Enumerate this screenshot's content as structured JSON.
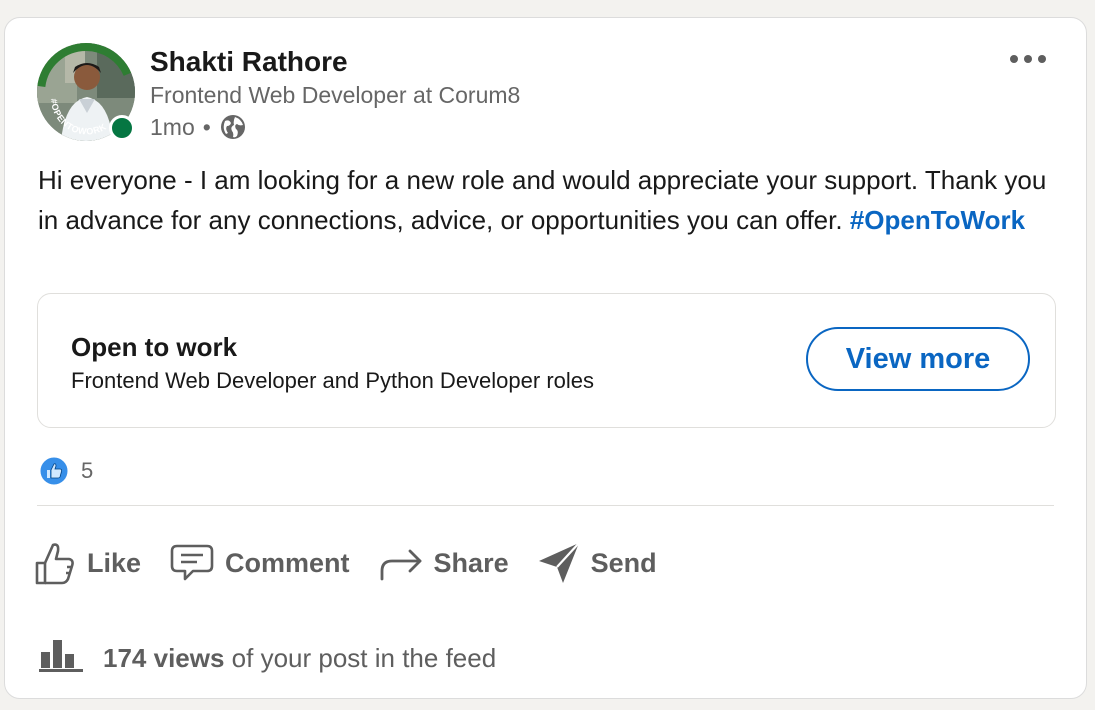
{
  "post": {
    "author": {
      "name": "Shakti Rathore",
      "headline": "Frontend Web Developer at Corum8",
      "time": "1mo",
      "separator": "•",
      "avatar_frame_text": "#OPENTOWORK",
      "visibility_icon": "globe-icon",
      "presence_color": "#057642"
    },
    "more_icon": "more-horizontal-icon",
    "text": {
      "body": "Hi everyone - I am looking for a new role and would appreciate your support. Thank you in advance for any connections, advice, or opportunities you can offer. ",
      "hashtag": "#OpenToWork"
    },
    "open_to_work": {
      "title": "Open to work",
      "subtitle": "Frontend Web Developer and Python Developer roles",
      "button_label": "View more"
    },
    "reactions": {
      "icon": "like-reaction-icon",
      "count": "5"
    },
    "actions": [
      {
        "label": "Like",
        "icon": "thumbs-up-icon"
      },
      {
        "label": "Comment",
        "icon": "comment-icon"
      },
      {
        "label": "Share",
        "icon": "share-arrow-icon"
      },
      {
        "label": "Send",
        "icon": "send-icon"
      }
    ],
    "views": {
      "icon": "bar-chart-icon",
      "count_label": "174 views",
      "suffix": "of your post in the feed"
    },
    "colors": {
      "accent": "#0a66c2",
      "muted_text": "#666666",
      "icon_gray": "#5e5e5e"
    }
  }
}
